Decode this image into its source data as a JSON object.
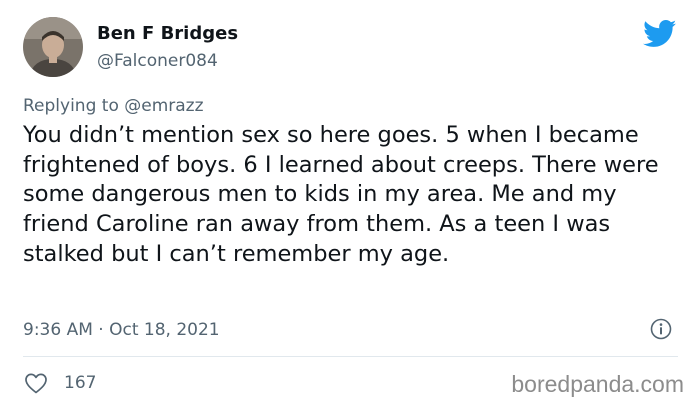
{
  "tweet": {
    "author": {
      "display_name": "Ben F Bridges",
      "handle": "@Falconer084"
    },
    "replying_to_prefix": "Replying to ",
    "replying_to_handle": "@emrazz",
    "text": "You didn’t mention sex so here goes. 5 when I became frightened of boys. 6 I learned about creeps. There were some dangerous men to kids in my area. Me and my friend Caroline ran away from them. As a teen I was stalked but I can’t remember my age.",
    "timestamp": "9:36 AM · Oct 18, 2021",
    "like_count": "167"
  },
  "watermark": "boredpanda.com",
  "icons": {
    "brand": "twitter-bird-icon",
    "info": "info-icon",
    "like": "heart-icon"
  },
  "colors": {
    "twitter_blue": "#1d9bf0",
    "secondary_text": "#536471",
    "primary_text": "#0f1419",
    "divider": "#e1e8ed",
    "watermark": "#8c8c8c"
  }
}
